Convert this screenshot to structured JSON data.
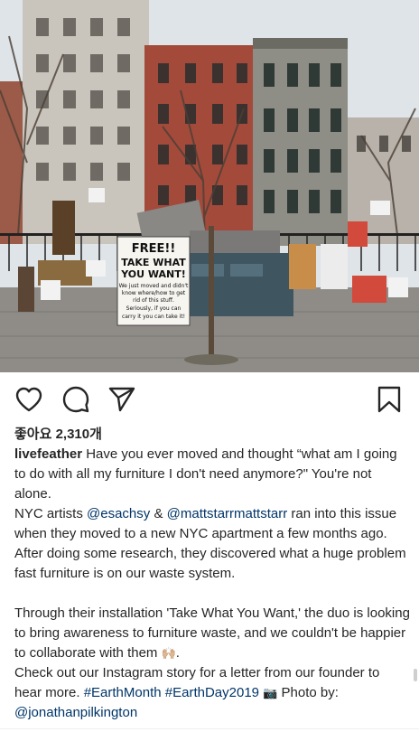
{
  "post": {
    "image_alt": "Furniture pile on a sidewalk with a FREE sign",
    "sign": {
      "line1": "FREE!!",
      "line2": "TAKE WHAT",
      "line3": "YOU WANT!",
      "line4": "We just moved and didn't",
      "line5": "know where/how to get",
      "line6": "rid of this stuff.",
      "line7": "Seriously, if you can",
      "line8": "carry it you can take it!"
    }
  },
  "actions": {
    "like_icon": "heart-outline",
    "comment_icon": "speech-bubble",
    "share_icon": "paper-plane",
    "save_icon": "bookmark"
  },
  "likes": {
    "label": "좋아요 2,310개"
  },
  "caption": {
    "username": "livefeather",
    "p1": "Have you ever moved and thought “what am I going to do with all my furniture I don't need anymore?\" You're not alone.",
    "p2_a": "NYC artists ",
    "mention1": "@esachsy",
    "p2_b": " & ",
    "mention2": "@mattstarrmattstarr",
    "p2_c": " ran into this issue when they moved to a new NYC apartment a few months ago. After doing some research, they discovered what a huge problem fast furniture is on our waste system.",
    "p3": "Through their installation 'Take What You Want,' the duo is looking to bring awareness to furniture waste, and we couldn't be happier to collaborate with them",
    "emoji_hands": "🙌🏼",
    "p3_end": ".",
    "p4_a": "Check out our Instagram story for a letter from our founder to hear more. ",
    "hashtag1": "#EarthMonth",
    "hashtag_sep": " ",
    "hashtag2": "#EarthDay2019",
    "emoji_camera": "📷",
    "p4_b": " Photo by: ",
    "mention3": "@jonathanpilkington"
  }
}
